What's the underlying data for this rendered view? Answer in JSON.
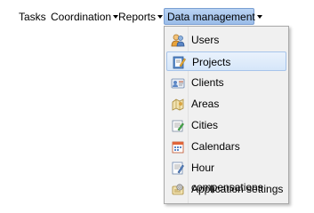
{
  "menubar": {
    "items": [
      {
        "label": "Tasks",
        "has_caret": false
      },
      {
        "label": "Coordination",
        "has_caret": true
      },
      {
        "label": "Reports",
        "has_caret": true
      },
      {
        "label": "Data management",
        "has_caret": true,
        "active": true
      }
    ]
  },
  "dropdown": {
    "items": [
      {
        "label": "Users",
        "icon": "users-icon"
      },
      {
        "label": "Projects",
        "icon": "projects-icon",
        "highlighted": true
      },
      {
        "label": "Clients",
        "icon": "clients-icon"
      },
      {
        "label": "Areas",
        "icon": "areas-icon"
      },
      {
        "label": "Cities",
        "icon": "cities-icon"
      },
      {
        "label": "Calendars",
        "icon": "calendars-icon"
      },
      {
        "label": "Hour compensations",
        "icon": "hour-compensations-icon"
      },
      {
        "label": "Application settings",
        "icon": "application-settings-icon"
      }
    ]
  },
  "colors": {
    "accent": "#9bbde9",
    "highlight": "#d6e6f9"
  }
}
